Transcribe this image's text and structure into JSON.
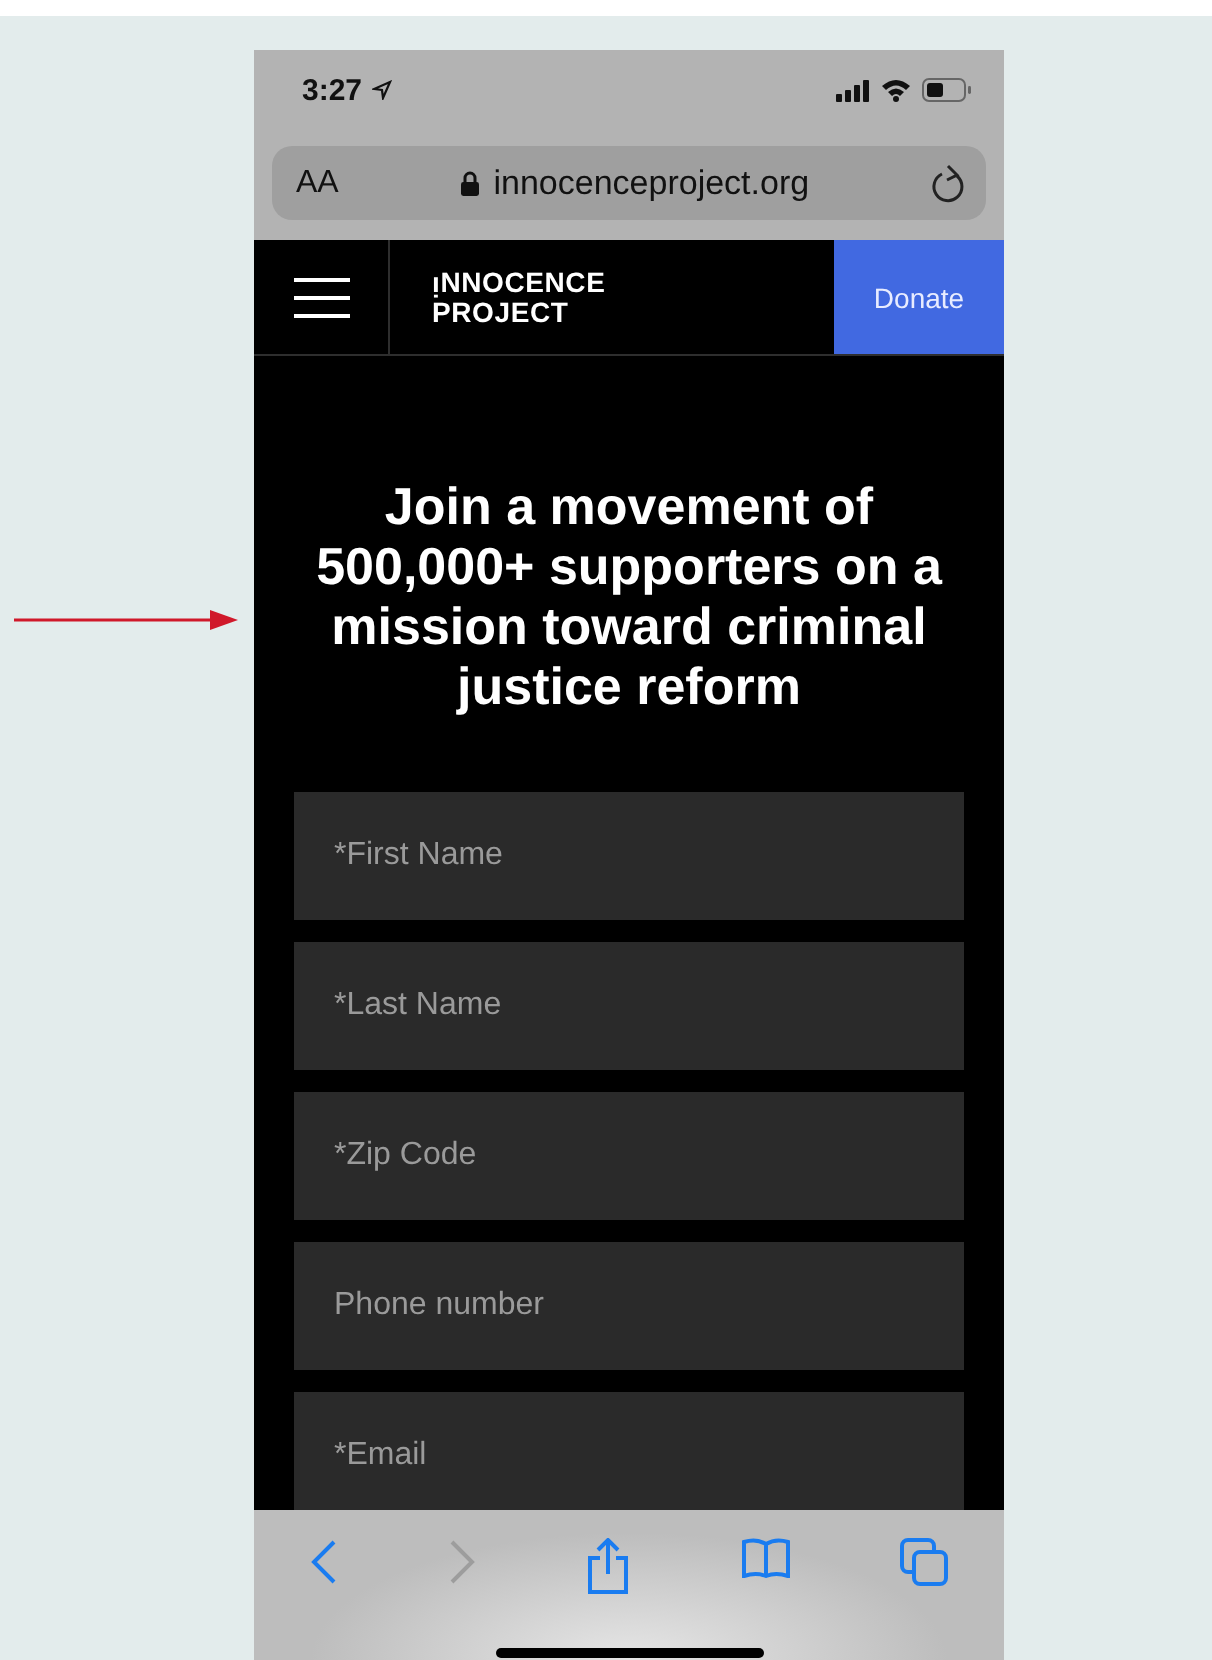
{
  "status_bar": {
    "time": "3:27"
  },
  "address_bar": {
    "text_size_button": "AA",
    "url": "innocenceproject.org"
  },
  "site_header": {
    "logo_lines": [
      "ᴉNNOCENCE",
      "PROJECT"
    ],
    "donate_button": "Donate"
  },
  "heading": "Join a movement of 500,000+ supporters on a mission toward criminal justice reform",
  "form_fields": [
    {
      "placeholder": "*First Name"
    },
    {
      "placeholder": "*Last Name"
    },
    {
      "placeholder": "*Zip Code"
    },
    {
      "placeholder": "Phone number"
    },
    {
      "placeholder": "*Email"
    }
  ],
  "toolbar": [
    {
      "kind": "back",
      "disabled": false
    },
    {
      "kind": "forward",
      "disabled": true
    },
    {
      "kind": "share",
      "disabled": false
    },
    {
      "kind": "bookmarks",
      "disabled": false
    },
    {
      "kind": "tabs",
      "disabled": false
    }
  ]
}
